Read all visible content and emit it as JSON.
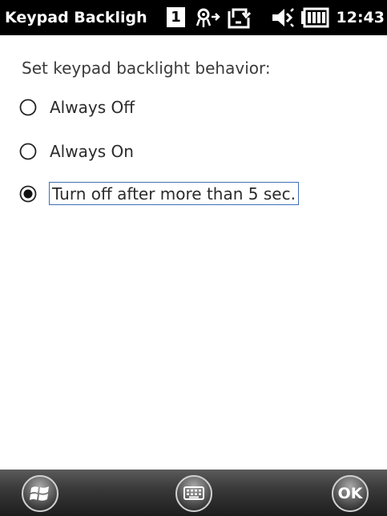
{
  "status_bar": {
    "title": "Keypad Backligh",
    "badge": "1",
    "time": "12:43",
    "icons": [
      "connectivity-icon",
      "sync-icon",
      "volume-muted-icon",
      "battery-icon"
    ]
  },
  "content": {
    "prompt": "Set keypad backlight behavior:",
    "options": [
      {
        "label": "Always Off",
        "selected": false
      },
      {
        "label": "Always On",
        "selected": false
      },
      {
        "label": "Turn off after more than 5 sec.",
        "selected": true
      }
    ]
  },
  "bottom_bar": {
    "buttons": [
      "start-button",
      "keyboard-button",
      "ok-button"
    ],
    "ok_label": "OK"
  }
}
